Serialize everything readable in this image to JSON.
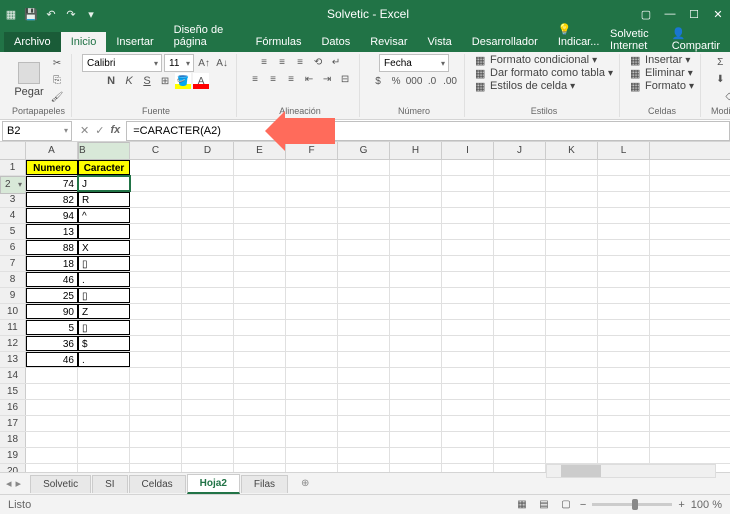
{
  "title": "Solvetic - Excel",
  "menus": {
    "file": "Archivo",
    "home": "Inicio",
    "insert": "Insertar",
    "layout": "Diseño de página",
    "formulas": "Fórmulas",
    "data": "Datos",
    "review": "Revisar",
    "view": "Vista",
    "dev": "Desarrollador",
    "tell": "Indicar..."
  },
  "account": "Solvetic Internet",
  "share": "Compartir",
  "ribbon": {
    "clipboard": {
      "paste": "Pegar",
      "label": "Portapapeles"
    },
    "font": {
      "name": "Calibri",
      "size": "11",
      "label": "Fuente"
    },
    "align": {
      "label": "Alineación"
    },
    "number": {
      "fmt": "Fecha",
      "label": "Número"
    },
    "styles": {
      "cond": "Formato condicional",
      "table": "Dar formato como tabla",
      "cell": "Estilos de celda",
      "label": "Estilos"
    },
    "cells": {
      "insert": "Insertar",
      "delete": "Eliminar",
      "format": "Formato",
      "label": "Celdas"
    },
    "editing": {
      "label": "Modificar"
    }
  },
  "namebox": "B2",
  "formula": "=CARACTER(A2)",
  "cols": [
    "A",
    "B",
    "C",
    "D",
    "E",
    "F",
    "G",
    "H",
    "I",
    "J",
    "K",
    "L"
  ],
  "headers": {
    "a": "Numero",
    "b": "Caracter"
  },
  "data": [
    {
      "n": "74",
      "c": "J"
    },
    {
      "n": "82",
      "c": "R"
    },
    {
      "n": "94",
      "c": "^"
    },
    {
      "n": "13",
      "c": ""
    },
    {
      "n": "88",
      "c": "X"
    },
    {
      "n": "18",
      "c": "▯"
    },
    {
      "n": "46",
      "c": "."
    },
    {
      "n": "25",
      "c": "▯"
    },
    {
      "n": "90",
      "c": "Z"
    },
    {
      "n": "5",
      "c": "▯"
    },
    {
      "n": "36",
      "c": "$"
    },
    {
      "n": "46",
      "c": "."
    }
  ],
  "sheets": {
    "s1": "Solvetic",
    "s2": "SI",
    "s3": "Celdas",
    "s4": "Hoja2",
    "s5": "Filas"
  },
  "status": "Listo",
  "zoom": "100 %"
}
